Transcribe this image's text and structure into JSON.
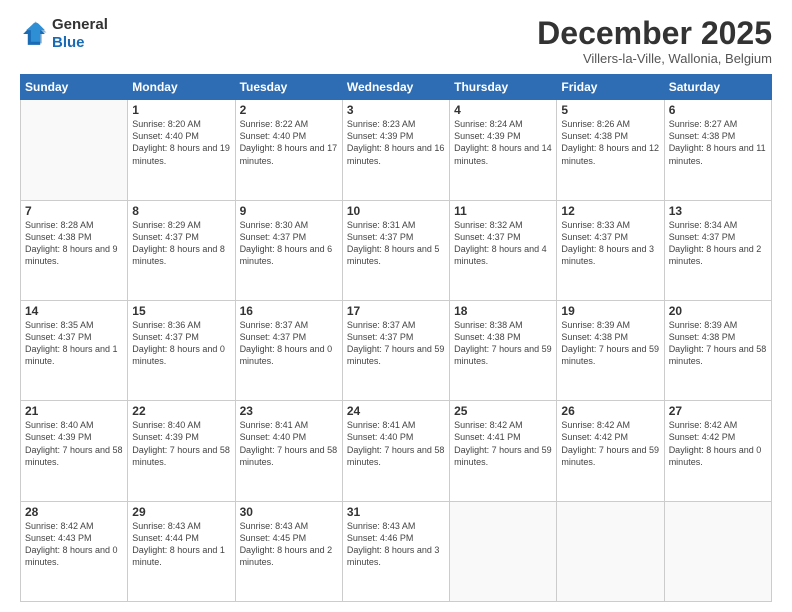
{
  "header": {
    "logo_general": "General",
    "logo_blue": "Blue",
    "month_title": "December 2025",
    "subtitle": "Villers-la-Ville, Wallonia, Belgium"
  },
  "weekdays": [
    "Sunday",
    "Monday",
    "Tuesday",
    "Wednesday",
    "Thursday",
    "Friday",
    "Saturday"
  ],
  "weeks": [
    [
      {
        "day": "",
        "info": ""
      },
      {
        "day": "1",
        "info": "Sunrise: 8:20 AM\nSunset: 4:40 PM\nDaylight: 8 hours\nand 19 minutes."
      },
      {
        "day": "2",
        "info": "Sunrise: 8:22 AM\nSunset: 4:40 PM\nDaylight: 8 hours\nand 17 minutes."
      },
      {
        "day": "3",
        "info": "Sunrise: 8:23 AM\nSunset: 4:39 PM\nDaylight: 8 hours\nand 16 minutes."
      },
      {
        "day": "4",
        "info": "Sunrise: 8:24 AM\nSunset: 4:39 PM\nDaylight: 8 hours\nand 14 minutes."
      },
      {
        "day": "5",
        "info": "Sunrise: 8:26 AM\nSunset: 4:38 PM\nDaylight: 8 hours\nand 12 minutes."
      },
      {
        "day": "6",
        "info": "Sunrise: 8:27 AM\nSunset: 4:38 PM\nDaylight: 8 hours\nand 11 minutes."
      }
    ],
    [
      {
        "day": "7",
        "info": "Sunrise: 8:28 AM\nSunset: 4:38 PM\nDaylight: 8 hours\nand 9 minutes."
      },
      {
        "day": "8",
        "info": "Sunrise: 8:29 AM\nSunset: 4:37 PM\nDaylight: 8 hours\nand 8 minutes."
      },
      {
        "day": "9",
        "info": "Sunrise: 8:30 AM\nSunset: 4:37 PM\nDaylight: 8 hours\nand 6 minutes."
      },
      {
        "day": "10",
        "info": "Sunrise: 8:31 AM\nSunset: 4:37 PM\nDaylight: 8 hours\nand 5 minutes."
      },
      {
        "day": "11",
        "info": "Sunrise: 8:32 AM\nSunset: 4:37 PM\nDaylight: 8 hours\nand 4 minutes."
      },
      {
        "day": "12",
        "info": "Sunrise: 8:33 AM\nSunset: 4:37 PM\nDaylight: 8 hours\nand 3 minutes."
      },
      {
        "day": "13",
        "info": "Sunrise: 8:34 AM\nSunset: 4:37 PM\nDaylight: 8 hours\nand 2 minutes."
      }
    ],
    [
      {
        "day": "14",
        "info": "Sunrise: 8:35 AM\nSunset: 4:37 PM\nDaylight: 8 hours\nand 1 minute."
      },
      {
        "day": "15",
        "info": "Sunrise: 8:36 AM\nSunset: 4:37 PM\nDaylight: 8 hours\nand 0 minutes."
      },
      {
        "day": "16",
        "info": "Sunrise: 8:37 AM\nSunset: 4:37 PM\nDaylight: 8 hours\nand 0 minutes."
      },
      {
        "day": "17",
        "info": "Sunrise: 8:37 AM\nSunset: 4:37 PM\nDaylight: 7 hours\nand 59 minutes."
      },
      {
        "day": "18",
        "info": "Sunrise: 8:38 AM\nSunset: 4:38 PM\nDaylight: 7 hours\nand 59 minutes."
      },
      {
        "day": "19",
        "info": "Sunrise: 8:39 AM\nSunset: 4:38 PM\nDaylight: 7 hours\nand 59 minutes."
      },
      {
        "day": "20",
        "info": "Sunrise: 8:39 AM\nSunset: 4:38 PM\nDaylight: 7 hours\nand 58 minutes."
      }
    ],
    [
      {
        "day": "21",
        "info": "Sunrise: 8:40 AM\nSunset: 4:39 PM\nDaylight: 7 hours\nand 58 minutes."
      },
      {
        "day": "22",
        "info": "Sunrise: 8:40 AM\nSunset: 4:39 PM\nDaylight: 7 hours\nand 58 minutes."
      },
      {
        "day": "23",
        "info": "Sunrise: 8:41 AM\nSunset: 4:40 PM\nDaylight: 7 hours\nand 58 minutes."
      },
      {
        "day": "24",
        "info": "Sunrise: 8:41 AM\nSunset: 4:40 PM\nDaylight: 7 hours\nand 58 minutes."
      },
      {
        "day": "25",
        "info": "Sunrise: 8:42 AM\nSunset: 4:41 PM\nDaylight: 7 hours\nand 59 minutes."
      },
      {
        "day": "26",
        "info": "Sunrise: 8:42 AM\nSunset: 4:42 PM\nDaylight: 7 hours\nand 59 minutes."
      },
      {
        "day": "27",
        "info": "Sunrise: 8:42 AM\nSunset: 4:42 PM\nDaylight: 8 hours\nand 0 minutes."
      }
    ],
    [
      {
        "day": "28",
        "info": "Sunrise: 8:42 AM\nSunset: 4:43 PM\nDaylight: 8 hours\nand 0 minutes."
      },
      {
        "day": "29",
        "info": "Sunrise: 8:43 AM\nSunset: 4:44 PM\nDaylight: 8 hours\nand 1 minute."
      },
      {
        "day": "30",
        "info": "Sunrise: 8:43 AM\nSunset: 4:45 PM\nDaylight: 8 hours\nand 2 minutes."
      },
      {
        "day": "31",
        "info": "Sunrise: 8:43 AM\nSunset: 4:46 PM\nDaylight: 8 hours\nand 3 minutes."
      },
      {
        "day": "",
        "info": ""
      },
      {
        "day": "",
        "info": ""
      },
      {
        "day": "",
        "info": ""
      }
    ]
  ]
}
